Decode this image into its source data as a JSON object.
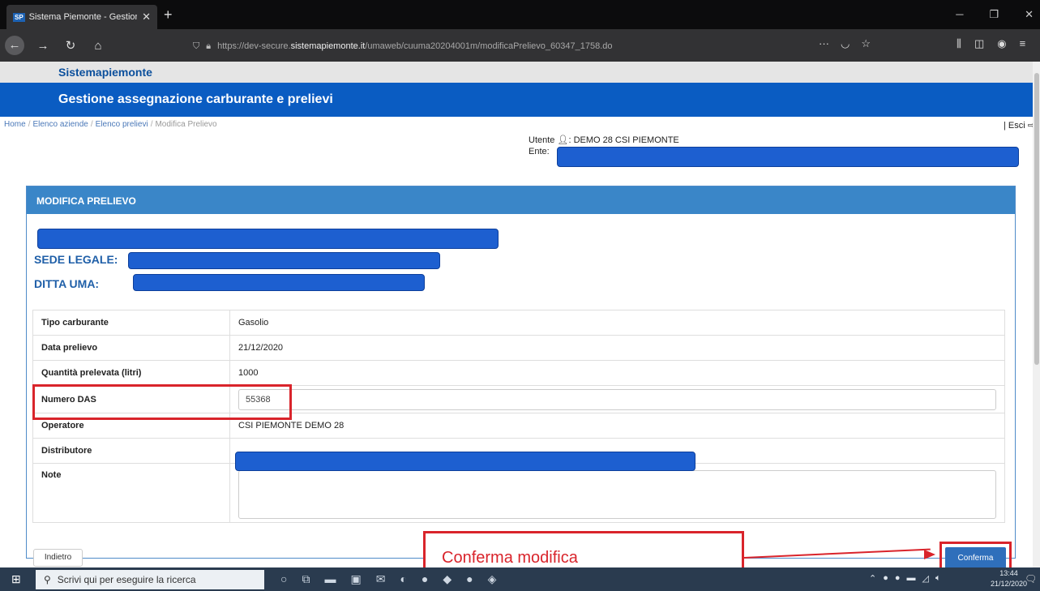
{
  "browser": {
    "tab_title": "Sistema Piemonte - Gestione a",
    "favicon_text": "SP",
    "url_prefix": "https://dev-secure.",
    "url_host": "sistemapiemonte.it",
    "url_path": "/umaweb/cuuma20204001m/modificaPrelievo_60347_1758.do"
  },
  "site": {
    "brand": "Sistemapiemonte",
    "app_title": "Gestione assegnazione carburante e prelievi"
  },
  "breadcrumb": {
    "home": "Home",
    "aziende": "Elenco aziende",
    "prelievi": "Elenco prelievi",
    "current": "Modifica Prelievo"
  },
  "logout_label": "| Esci",
  "user": {
    "utente_label": "Utente",
    "utente_value": ": DEMO 28 CSI PIEMONTE",
    "ente_label": "Ente:"
  },
  "panel": {
    "title": "MODIFICA PRELIEVO",
    "sede_label": "SEDE LEGALE:",
    "ditta_label": "DITTA UMA:"
  },
  "form": {
    "rows": [
      {
        "label": "Tipo carburante",
        "value": "Gasolio"
      },
      {
        "label": "Data prelievo",
        "value": "21/12/2020"
      },
      {
        "label": "Quantità prelevata (litri)",
        "value": "1000"
      }
    ],
    "das_label": "Numero DAS",
    "das_value": "55368",
    "operatore_label": "Operatore",
    "operatore_value": "CSI PIEMONTE DEMO 28",
    "distributore_label": "Distributore",
    "note_label": "Note"
  },
  "buttons": {
    "back": "Indietro",
    "confirm": "Conferma"
  },
  "annotation": {
    "callout_text": "Conferma modifica",
    "color": "#d9242b"
  },
  "taskbar": {
    "search_placeholder": "Scrivi qui per eseguire la ricerca",
    "time": "13:44",
    "date": "21/12/2020"
  },
  "colors": {
    "brand_blue": "#0a5cc2",
    "panel_header": "#3a86c8",
    "redaction": "#1d5fd0"
  }
}
